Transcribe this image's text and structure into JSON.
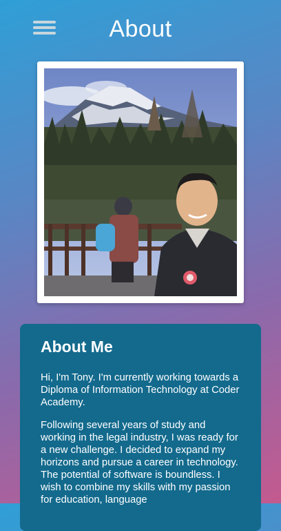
{
  "header": {
    "title": "About",
    "menu_icon": "hamburger-menu-icon"
  },
  "photo": {
    "description_icon": "profile-photo"
  },
  "about": {
    "heading": "About Me",
    "paragraphs": [
      "Hi, I'm Tony. I'm currently working towards a Diploma of Information Technology at Coder Academy.",
      "Following several years of study and working in the legal industry, I was ready for a new challenge. I decided to expand my horizons and pursue a career in technology. The potential of software is boundless. I wish to combine my skills with my passion for education, language"
    ]
  },
  "colors": {
    "gradient_top": "#2f9fd6",
    "gradient_bottom": "#c45a8f",
    "card_background": "#136a8d",
    "text": "#ffffff"
  }
}
